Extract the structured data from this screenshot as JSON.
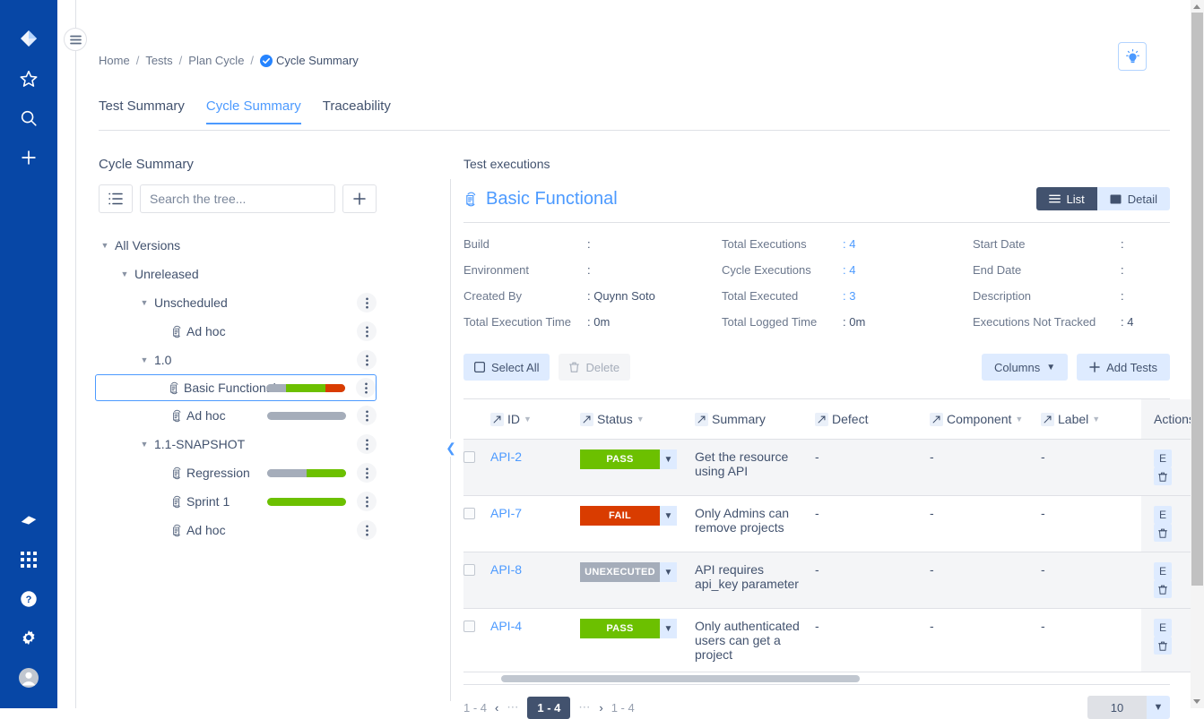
{
  "nav_rail": {
    "top_icons": [
      {
        "name": "jira-logo-icon",
        "label": "Jira"
      },
      {
        "name": "star-icon",
        "label": "Starred"
      },
      {
        "name": "search-icon",
        "label": "Search"
      },
      {
        "name": "plus-icon",
        "label": "Create"
      }
    ],
    "bottom_icons": [
      {
        "name": "feedback-icon",
        "label": "Feedback"
      },
      {
        "name": "apps-grid-icon",
        "label": "Switch to"
      },
      {
        "name": "help-icon",
        "label": "Help"
      },
      {
        "name": "settings-gear-icon",
        "label": "Settings"
      },
      {
        "name": "avatar-icon",
        "label": "Your profile"
      }
    ]
  },
  "header": {
    "menu_button": "menu-icon",
    "lightbulb": "lightbulb-icon",
    "breadcrumb": [
      {
        "label": "Home"
      },
      {
        "label": "Tests"
      },
      {
        "label": "Plan Cycle"
      },
      {
        "label": "Cycle Summary",
        "current": true
      }
    ],
    "separator": "/"
  },
  "tabs": [
    {
      "label": "Test Summary",
      "active": false
    },
    {
      "label": "Cycle Summary",
      "active": true
    },
    {
      "label": "Traceability",
      "active": false
    }
  ],
  "tree_panel": {
    "title": "Cycle Summary",
    "list_view_button": "list-view-icon",
    "add_button": "+",
    "search": {
      "value": "",
      "placeholder": "Search the tree..."
    },
    "items": [
      {
        "label": "All Versions",
        "depth": 0,
        "twisty": true,
        "expanded": true,
        "cycle_icon": false,
        "kebab": false,
        "bar": null
      },
      {
        "label": "Unreleased",
        "depth": 1,
        "twisty": true,
        "expanded": true,
        "cycle_icon": false,
        "kebab": false,
        "bar": null
      },
      {
        "label": "Unscheduled",
        "depth": 2,
        "twisty": true,
        "expanded": true,
        "cycle_icon": false,
        "kebab": true,
        "bar": null
      },
      {
        "label": "Ad hoc",
        "depth": 3,
        "twisty": false,
        "cycle_icon": true,
        "kebab": true,
        "bar": null
      },
      {
        "label": "1.0",
        "depth": 2,
        "twisty": true,
        "expanded": true,
        "cycle_icon": false,
        "kebab": true,
        "bar": null
      },
      {
        "label": "Basic Functional",
        "depth": 3,
        "twisty": false,
        "cycle_icon": true,
        "kebab": true,
        "selected": true,
        "bar": [
          {
            "color": "#A5ADBA",
            "pct": 25
          },
          {
            "color": "#6CC000",
            "pct": 50
          },
          {
            "color": "#D93C00",
            "pct": 25
          }
        ]
      },
      {
        "label": "Ad hoc",
        "depth": 3,
        "twisty": false,
        "cycle_icon": true,
        "kebab": true,
        "bar": [
          {
            "color": "#A5ADBA",
            "pct": 100
          }
        ]
      },
      {
        "label": "1.1-SNAPSHOT",
        "depth": 2,
        "twisty": true,
        "expanded": true,
        "cycle_icon": false,
        "kebab": true,
        "bar": null
      },
      {
        "label": "Regression",
        "depth": 3,
        "twisty": false,
        "cycle_icon": true,
        "kebab": true,
        "bar": [
          {
            "color": "#A5ADBA",
            "pct": 50
          },
          {
            "color": "#6CC000",
            "pct": 50
          }
        ]
      },
      {
        "label": "Sprint 1",
        "depth": 3,
        "twisty": false,
        "cycle_icon": true,
        "kebab": true,
        "bar": [
          {
            "color": "#6CC000",
            "pct": 100
          }
        ]
      },
      {
        "label": "Ad hoc",
        "depth": 3,
        "twisty": false,
        "cycle_icon": true,
        "kebab": true,
        "bar": null
      }
    ]
  },
  "content": {
    "subtitle": "Test executions",
    "cycle_name": "Basic Functional",
    "view_toggle": [
      {
        "label": "List",
        "active": true,
        "icon": "list-lines-icon"
      },
      {
        "label": "Detail",
        "active": false,
        "icon": "detail-square-icon"
      }
    ],
    "meta": [
      {
        "key": "Build",
        "value": "",
        "link": false
      },
      {
        "key": "Total Executions",
        "value": "4",
        "link": true
      },
      {
        "key": "Start Date",
        "value": "",
        "link": false
      },
      {
        "key": "Environment",
        "value": "",
        "link": false
      },
      {
        "key": "Cycle Executions",
        "value": "4",
        "link": true
      },
      {
        "key": "End Date",
        "value": "",
        "link": false
      },
      {
        "key": "Created By",
        "value": "Quynn Soto",
        "link": false
      },
      {
        "key": "Total Executed",
        "value": "3",
        "link": true
      },
      {
        "key": "Description",
        "value": "",
        "link": false
      },
      {
        "key": "Total Execution Time",
        "value": "0m",
        "link": false
      },
      {
        "key": "Total Logged Time",
        "value": "0m",
        "link": false
      },
      {
        "key": "Executions Not Tracked",
        "value": "4",
        "link": false
      }
    ],
    "action_bar": {
      "select_all": "Select All",
      "delete": "Delete",
      "columns": "Columns",
      "add_tests": "Add Tests"
    },
    "table": {
      "columns": [
        {
          "label": "ID",
          "pin": true,
          "sortable": true
        },
        {
          "label": "Status",
          "pin": true,
          "sortable": true
        },
        {
          "label": "Summary",
          "pin": true,
          "sortable": false
        },
        {
          "label": "Defect",
          "pin": true,
          "sortable": false
        },
        {
          "label": "Component",
          "pin": true,
          "sortable": true
        },
        {
          "label": "Label",
          "pin": true,
          "sortable": true
        },
        {
          "label": "Actions",
          "pin": false,
          "sortable": false
        }
      ],
      "rows": [
        {
          "id": "API-2",
          "status": "PASS",
          "status_class": "pass",
          "summary": "Get the resource using API",
          "defect": "-",
          "component": "-",
          "label": "-",
          "actions": [
            "E",
            "trash-icon"
          ]
        },
        {
          "id": "API-7",
          "status": "FAIL",
          "status_class": "fail",
          "summary": "Only Admins can remove projects",
          "defect": "-",
          "component": "-",
          "label": "-",
          "actions": [
            "E",
            "trash-icon"
          ]
        },
        {
          "id": "API-8",
          "status": "UNEXECUTED",
          "status_class": "unexecuted",
          "summary": "API requires api_key parameter",
          "defect": "-",
          "component": "-",
          "label": "-",
          "actions": [
            "E",
            "trash-icon"
          ]
        },
        {
          "id": "API-4",
          "status": "PASS",
          "status_class": "pass",
          "summary": "Only authenticated users can get a project",
          "defect": "-",
          "component": "-",
          "label": "-",
          "actions": [
            "E",
            "trash-icon"
          ]
        }
      ]
    },
    "pagination": {
      "left_range": "1 - 4",
      "prev": "‹",
      "dots_left": "⋯",
      "current": "1 - 4",
      "dots_right": "⋯",
      "next": "›",
      "right_range": "1 - 4",
      "page_size": "10"
    }
  },
  "colors": {
    "nav_blue": "#0747A6",
    "link_blue": "#4C9AFF",
    "pass_green": "#6CC000",
    "fail_red": "#D93C00",
    "unexecuted_gray": "#A5ADBA",
    "dark_slate": "#42526E",
    "pale_blue": "#DEEBFF"
  }
}
